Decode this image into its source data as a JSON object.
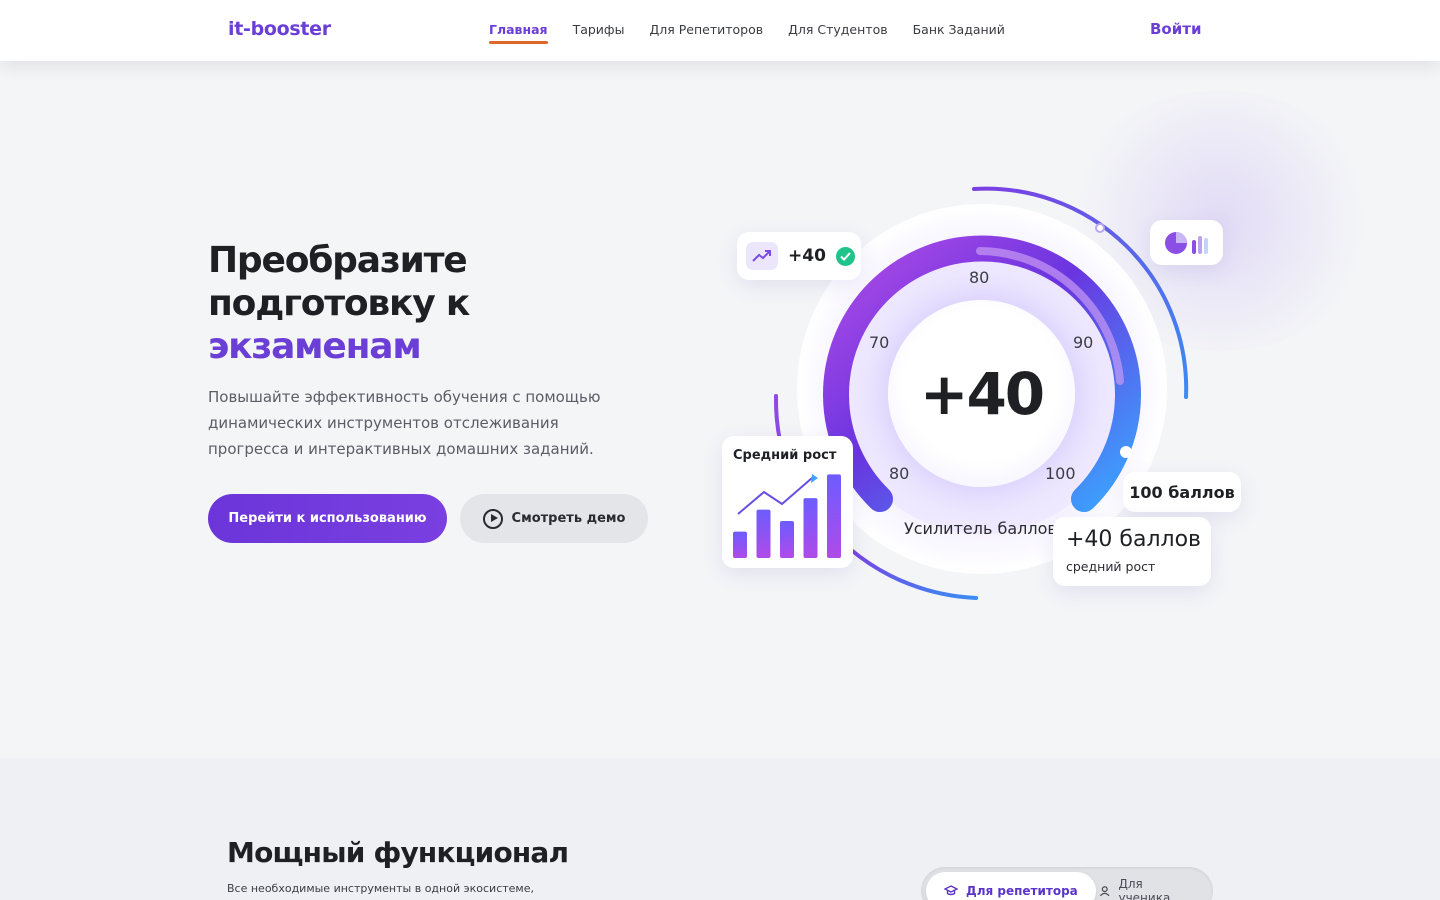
{
  "header": {
    "logo": "it-booster",
    "nav": [
      {
        "label": "Главная",
        "active": true
      },
      {
        "label": "Тарифы",
        "active": false
      },
      {
        "label": "Для Репетиторов",
        "active": false
      },
      {
        "label": "Для Студентов",
        "active": false
      },
      {
        "label": "Банк Заданий",
        "active": false
      }
    ],
    "login_label": "Войти"
  },
  "hero": {
    "title_line1": "Преобразите",
    "title_line2": "подготовку к",
    "title_accent": "экзаменам",
    "lead": "Повышайте эффективность обучения с помощью динамических инструментов отслеживания прогресса и интерактивных домашних заданий.",
    "primary_button": "Перейти к использованию",
    "secondary_button": "Смотреть демо",
    "gauge": {
      "value": "+40",
      "ticks": [
        "80",
        "70",
        "90",
        "80",
        "100"
      ],
      "caption": "Усилитель баллов"
    },
    "badge_top": "+40",
    "growth_card_title": "Средний рост",
    "growth_bars": [
      0.3,
      0.55,
      0.42,
      0.68,
      0.95
    ],
    "score_card": "100 баллов",
    "avg_card_title": "+40 баллов",
    "avg_card_sub": "средний рост"
  },
  "features": {
    "title": "Мощный функционал",
    "subtitle": "Все необходимые инструменты в одной экосистеме,",
    "toggle": [
      {
        "label": "Для репетитора",
        "icon": "graduation-cap-icon",
        "active": true
      },
      {
        "label": "Для ученика",
        "icon": "user-icon",
        "active": false
      }
    ]
  },
  "colors": {
    "accent": "#6b3fd6",
    "nav_underline": "#e0672a",
    "success": "#1fc48a"
  }
}
